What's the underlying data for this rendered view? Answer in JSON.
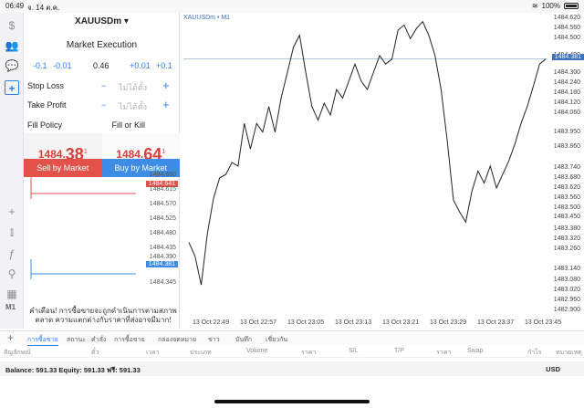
{
  "status": {
    "time": "06:49",
    "date": "จ. 14 ต.ค.",
    "battery": "100%"
  },
  "trade": {
    "symbol": "XAUUSDm",
    "mode": "Market Execution",
    "steps": [
      "-0.1",
      "-0.01",
      "0.46",
      "+0.01",
      "+0.1"
    ],
    "stop_loss": {
      "label": "Stop Loss",
      "value": "ไม่ได้ตั้ง"
    },
    "take_profit": {
      "label": "Take Profit",
      "value": "ไม่ได้ตั้ง"
    },
    "fill_policy": {
      "label": "Fill Policy",
      "value": "Fill or Kill"
    },
    "sell": {
      "big": "1484.",
      "big2": "38",
      "sup": "1",
      "button": "Sell by Market"
    },
    "buy": {
      "big": "1484.",
      "big2": "64",
      "sup": "1",
      "button": "Buy by Market"
    },
    "mini_ticks": [
      "1484.660",
      "1484.615",
      "1484.570",
      "1484.525",
      "1484.480",
      "1484.435",
      "1484.390",
      "1484.345"
    ],
    "mini_ask": "1484.641",
    "mini_bid": "1484.381",
    "warning": "คำเตือน! การซื้อขายจะถูกดำเนินการตามสภาพตลาด ความแตกต่างกับราคาที่ส่งอาจมีมาก!"
  },
  "chart_data": {
    "type": "line",
    "title": "XAUUSDm • M1",
    "y_ticks": [
      "1484.620",
      "1484.560",
      "1484.500",
      "1484.400",
      "1484.300",
      "1484.240",
      "1484.180",
      "1484.120",
      "1484.060",
      "1483.950",
      "1483.860",
      "1483.740",
      "1483.680",
      "1483.620",
      "1483.560",
      "1483.500",
      "1483.450",
      "1483.380",
      "1483.320",
      "1483.260",
      "1483.140",
      "1483.080",
      "1483.020",
      "1482.960",
      "1482.900"
    ],
    "current_price": "1484.381",
    "x_labels": [
      "13 Oct 22:49",
      "13 Oct 22:57",
      "13 Oct 23:05",
      "13 Oct 23:13",
      "13 Oct 23:21",
      "13 Oct 23:29",
      "13 Oct 23:37",
      "13 Oct 23:45"
    ],
    "values": [
      1483.3,
      1483.22,
      1483.05,
      1483.35,
      1483.56,
      1483.68,
      1483.7,
      1483.77,
      1483.75,
      1484.0,
      1483.85,
      1484.0,
      1483.95,
      1484.1,
      1483.95,
      1484.15,
      1484.3,
      1484.45,
      1484.52,
      1484.3,
      1484.1,
      1484.02,
      1484.12,
      1484.05,
      1484.2,
      1484.15,
      1484.25,
      1484.35,
      1484.25,
      1484.2,
      1484.3,
      1484.4,
      1484.35,
      1484.38,
      1484.55,
      1484.58,
      1484.5,
      1484.56,
      1484.6,
      1484.52,
      1484.4,
      1484.2,
      1483.9,
      1483.55,
      1483.48,
      1483.42,
      1483.6,
      1483.72,
      1483.65,
      1483.75,
      1483.62,
      1483.7,
      1483.78,
      1483.88,
      1484.0,
      1484.1,
      1484.22,
      1484.35,
      1484.38
    ]
  },
  "bottom": {
    "tabs": [
      "การซื้อขาย",
      "สถานะ",
      "คำสั่ง",
      "การซื้อขาย",
      "กล่องจดหมาย",
      "ข่าว",
      "บันทึก",
      "เชี่ยวกัน"
    ],
    "columns": [
      "สัญลักษณ์",
      "ตั๋ว",
      "เวลา",
      "ประเภท",
      "Volume",
      "ราคา",
      "S/L",
      "T/P",
      "ราคา",
      "Swap",
      "กำไร",
      "หมายเหตุ"
    ],
    "balance": "Balance: 591.33 Equity: 591.33 ฟรี: 591.33",
    "currency": "USD"
  }
}
